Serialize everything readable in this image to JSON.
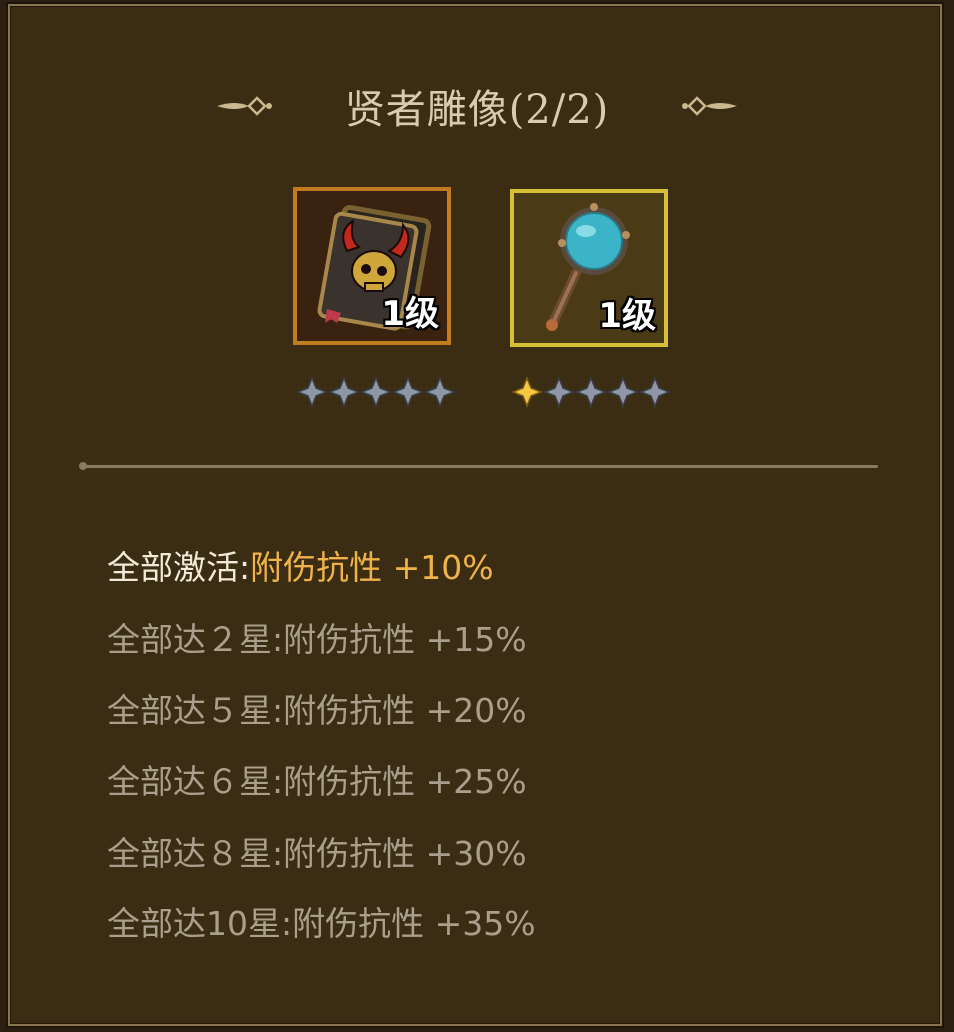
{
  "dialog": {
    "title": "贤者雕像(2/2)"
  },
  "items": [
    {
      "name": "book",
      "level": "1级",
      "stars_lit": 0,
      "stars_total": 5
    },
    {
      "name": "mirror",
      "level": "1级",
      "stars_lit": 1,
      "stars_total": 5
    }
  ],
  "bonuses": [
    {
      "label": "全部激活:",
      "value": "附伤抗性 +10%",
      "active": true
    },
    {
      "label": "全部达２星:",
      "value": "附伤抗性 +15%",
      "active": false
    },
    {
      "label": "全部达５星:",
      "value": "附伤抗性 +20%",
      "active": false
    },
    {
      "label": "全部达６星:",
      "value": "附伤抗性 +25%",
      "active": false
    },
    {
      "label": "全部达８星:",
      "value": "附伤抗性 +30%",
      "active": false
    },
    {
      "label": "全部达10星:",
      "value": "附伤抗性 +35%",
      "active": false
    }
  ],
  "colors": {
    "active_value": "#f0b24a",
    "inactive_text": "#a89f8c",
    "panel_bg": "#3b2d13",
    "star_lit": "#f4c842",
    "star_unlit": "#8e97a3"
  }
}
